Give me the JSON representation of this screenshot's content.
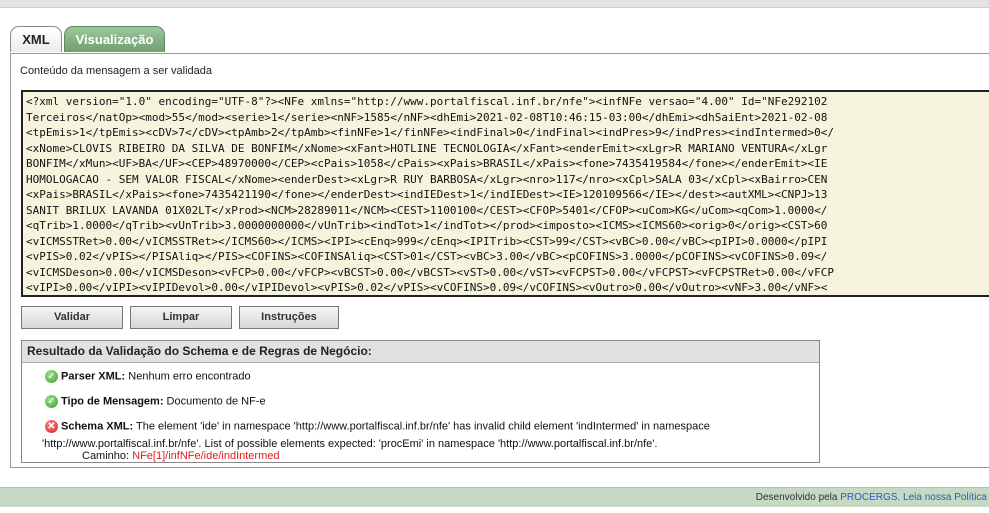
{
  "tabs": [
    {
      "label": "XML"
    },
    {
      "label": "Visualização"
    }
  ],
  "panel": {
    "label": "Conteúdo da mensagem a ser validada"
  },
  "xml_lines": [
    "<?xml version=\"1.0\" encoding=\"UTF-8\"?><NFe xmlns=\"http://www.portalfiscal.inf.br/nfe\"><infNFe versao=\"4.00\" Id=\"NFe292102",
    "Terceiros</natOp><mod>55</mod><serie>1</serie><nNF>1585</nNF><dhEmi>2021-02-08T10:46:15-03:00</dhEmi><dhSaiEnt>2021-02-08",
    "<tpEmis>1</tpEmis><cDV>7</cDV><tpAmb>2</tpAmb><finNFe>1</finNFe><indFinal>0</indFinal><indPres>9</indPres><indIntermed>0</",
    "<xNome>CLOVIS RIBEIRO DA SILVA DE BONFIM</xNome><xFant>HOTLINE TECNOLOGIA</xFant><enderEmit><xLgr>R MARIANO VENTURA</xLgr",
    "BONFIM</xMun><UF>BA</UF><CEP>48970000</CEP><cPais>1058</cPais><xPais>BRASIL</xPais><fone>7435419584</fone></enderEmit><IE",
    "HOMOLOGACAO - SEM VALOR FISCAL</xNome><enderDest><xLgr>R RUY BARBOSA</xLgr><nro>117</nro><xCpl>SALA 03</xCpl><xBairro>CEN",
    "<xPais>BRASIL</xPais><fone>7435421190</fone></enderDest><indIEDest>1</indIEDest><IE>120109566</IE></dest><autXML><CNPJ>13",
    "SANIT BRILUX LAVANDA 01X02LT</xProd><NCM>28289011</NCM><CEST>1100100</CEST><CFOP>5401</CFOP><uCom>KG</uCom><qCom>1.0000</",
    "<qTrib>1.0000</qTrib><vUnTrib>3.0000000000</vUnTrib><indTot>1</indTot></prod><imposto><ICMS><ICMS60><orig>0</orig><CST>60",
    "<vICMSSTRet>0.00</vICMSSTRet></ICMS60></ICMS><IPI><cEnq>999</cEnq><IPITrib><CST>99</CST><vBC>0.00</vBC><pIPI>0.0000</pIPI",
    "<vPIS>0.02</vPIS></PISAliq></PIS><COFINS><COFINSAliq><CST>01</CST><vBC>3.00</vBC><pCOFINS>3.0000</pCOFINS><vCOFINS>0.09</",
    "<vICMSDeson>0.00</vICMSDeson><vFCP>0.00</vFCP><vBCST>0.00</vBCST><vST>0.00</vST><vFCPST>0.00</vFCPST><vFCPSTRet>0.00</vFCP",
    "<vIPI>0.00</vIPI><vIPIDevol>0.00</vIPIDevol><vPIS>0.02</vPIS><vCOFINS>0.09</vCOFINS><vOutro>0.00</vOutro><vNF>3.00</vNF><"
  ],
  "buttons": {
    "validar": "Validar",
    "limpar": "Limpar",
    "instrucoes": "Instruções"
  },
  "result": {
    "title": "Resultado da Validação do Schema e de Regras de Negócio:",
    "parser": {
      "label": "Parser XML:",
      "value": "Nenhum erro encontrado"
    },
    "tipo": {
      "label": "Tipo de Mensagem:",
      "value": "Documento de NF-e"
    },
    "schema": {
      "label": "Schema XML:",
      "line1": "The element 'ide' in namespace 'http://www.portalfiscal.inf.br/nfe' has invalid child element 'indIntermed' in namespace",
      "line2": "'http://www.portalfiscal.inf.br/nfe'. List of possible elements expected: 'procEmi' in namespace 'http://www.portalfiscal.inf.br/nfe'.",
      "path_label": "Caminho:",
      "path_value": "NFe[1]/infNFe/ide/indIntermed"
    }
  },
  "footer": {
    "text": "Desenvolvido pela",
    "link1": "PROCERGS.",
    "link2": "Leia nossa Política"
  },
  "colors": {
    "tab_active": "#7aa77a",
    "xml_bg": "#f7f4de",
    "error": "#e31b1b",
    "footer_bg": "#c5d9c4",
    "link": "#2a5db0"
  }
}
